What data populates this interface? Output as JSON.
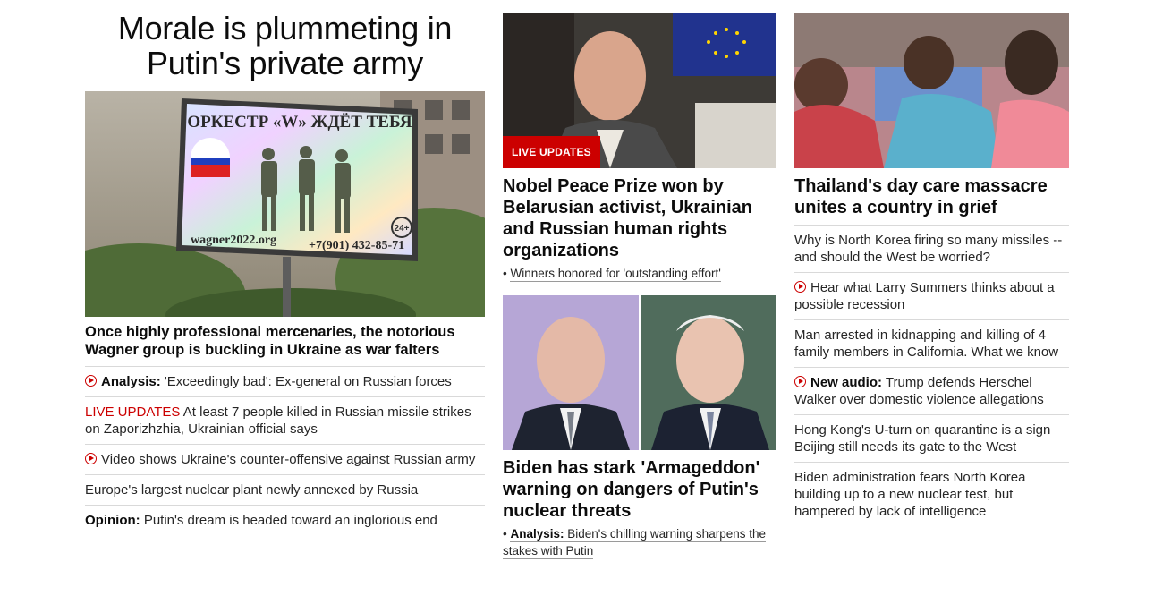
{
  "colors": {
    "accent": "#cc0000",
    "text": "#0c0c0c",
    "divider": "#d9d9d9"
  },
  "lead": {
    "headline": "Morale is plummeting in Putin's private army",
    "image": {
      "icon": "wagner-billboard-photo",
      "billboard_text": "ОРКЕСТР «W» ЖДЁТ ТЕБЯ",
      "billboard_site": "wagner2022.org",
      "billboard_phone": "+7(901) 432-85-71",
      "billboard_age": "24+"
    },
    "subheadline": "Once highly professional mercenaries, the notorious Wagner group is buckling in Ukraine as war falters",
    "items": [
      {
        "video": true,
        "prefix": "Analysis:",
        "text": "'Exceedingly bad': Ex-general on Russian forces"
      },
      {
        "live": "LIVE UPDATES",
        "text": "At least 7 people killed in Russian missile strikes on Zaporizhzhia, Ukrainian official says"
      },
      {
        "video": true,
        "text": "Video shows Ukraine's counter-offensive against Russian army"
      },
      {
        "text": "Europe's largest nuclear plant newly annexed by Russia"
      },
      {
        "prefix": "Opinion:",
        "text": "Putin's dream is headed toward an inglorious end"
      }
    ]
  },
  "middle": {
    "card1": {
      "badge": "LIVE UPDATES",
      "title": "Nobel Peace Prize won by Belarusian activist, Ukrainian and Russian human rights organizations",
      "sub": "Winners honored for 'outstanding effort'"
    },
    "card2": {
      "title": "Biden has stark 'Armageddon' warning on dangers of Putin's nuclear threats",
      "sub_prefix": "Analysis:",
      "sub": "Biden's chilling warning sharpens the stakes with Putin"
    }
  },
  "right": {
    "card": {
      "title": "Thailand's day care massacre unites a country in grief"
    },
    "items": [
      {
        "text": "Why is North Korea firing so many missiles -- and should the West be worried?"
      },
      {
        "video": true,
        "text": "Hear what Larry Summers thinks about a possible recession"
      },
      {
        "text": "Man arrested in kidnapping and killing of 4 family members in California. What we know"
      },
      {
        "video": true,
        "prefix": "New audio:",
        "text": "Trump defends Herschel Walker over domestic violence allegations"
      },
      {
        "text": "Hong Kong's U-turn on quarantine is a sign Beijing still needs its gate to the West"
      },
      {
        "text": "Biden administration fears North Korea building up to a new nuclear test, but hampered by lack of intelligence"
      }
    ]
  }
}
